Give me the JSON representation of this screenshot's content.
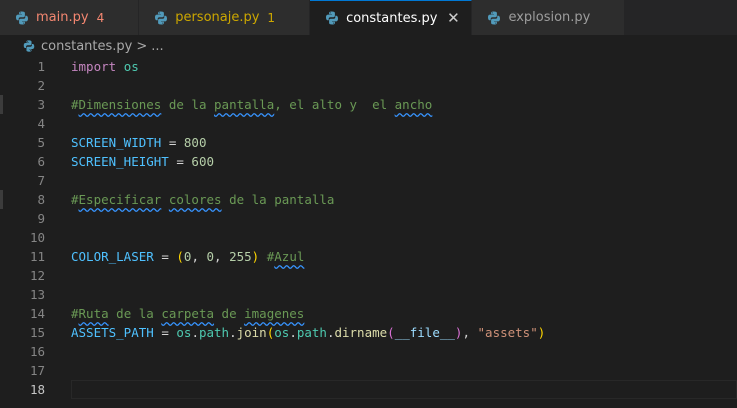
{
  "tabs": [
    {
      "label": "main.py",
      "badge": "4",
      "state": "err"
    },
    {
      "label": "personaje.py",
      "badge": "1",
      "state": "warn"
    },
    {
      "label": "constantes.py",
      "badge": "",
      "state": "active"
    },
    {
      "label": "explosion.py",
      "badge": "",
      "state": "normal"
    }
  ],
  "tab_close_glyph": "✕",
  "breadcrumb": {
    "file": "constantes.py",
    "separator": ">",
    "more": "..."
  },
  "code": {
    "l1": {
      "num": "1",
      "import": "import",
      "mod": "os"
    },
    "l2": {
      "num": "2"
    },
    "l3": {
      "num": "3",
      "c1": "#",
      "c2": "Dimensiones",
      "c3": " de la ",
      "c4": "pantalla",
      "c5": ", el alto y  el ",
      "c6": "ancho"
    },
    "l4": {
      "num": "4"
    },
    "l5": {
      "num": "5",
      "name": "SCREEN_WIDTH",
      "eq": " = ",
      "val": "800"
    },
    "l6": {
      "num": "6",
      "name": "SCREEN_HEIGHT",
      "eq": " = ",
      "val": "600"
    },
    "l7": {
      "num": "7"
    },
    "l8": {
      "num": "8",
      "c1": "#",
      "c2": "Especificar",
      "c3": " ",
      "c4": "colores",
      "c5": " de la pantalla"
    },
    "l9": {
      "num": "9"
    },
    "l10": {
      "num": "10"
    },
    "l11": {
      "num": "11",
      "name": "COLOR_LASER",
      "eq": " = ",
      "p1": "(",
      "v1": "0",
      "comma1": ", ",
      "v2": "0",
      "comma2": ", ",
      "v3": "255",
      "p2": ")",
      "sp": " ",
      "c1": "#",
      "c2": "Azul"
    },
    "l12": {
      "num": "12"
    },
    "l13": {
      "num": "13"
    },
    "l14": {
      "num": "14",
      "c1": "#",
      "c2": "Ruta",
      "c3": " de la ",
      "c4": "carpeta",
      "c5": " de ",
      "c6": "imagenes"
    },
    "l15": {
      "num": "15",
      "name": "ASSETS_PATH",
      "eq": " = ",
      "os1": "os",
      "d1": ".",
      "path1": "path",
      "d2": ".",
      "join": "join",
      "p1": "(",
      "os2": "os",
      "d3": ".",
      "path2": "path",
      "d4": ".",
      "dirname": "dirname",
      "p2": "(",
      "file": "__file__",
      "p3": ")",
      "comma": ", ",
      "str": "\"assets\"",
      "p4": ")"
    },
    "l16": {
      "num": "16"
    },
    "l17": {
      "num": "17"
    },
    "l18": {
      "num": "18"
    }
  },
  "colors": {
    "accent": "#0078d4",
    "error": "#f48771",
    "warning": "#cca700",
    "python_icon": "#519aba"
  }
}
